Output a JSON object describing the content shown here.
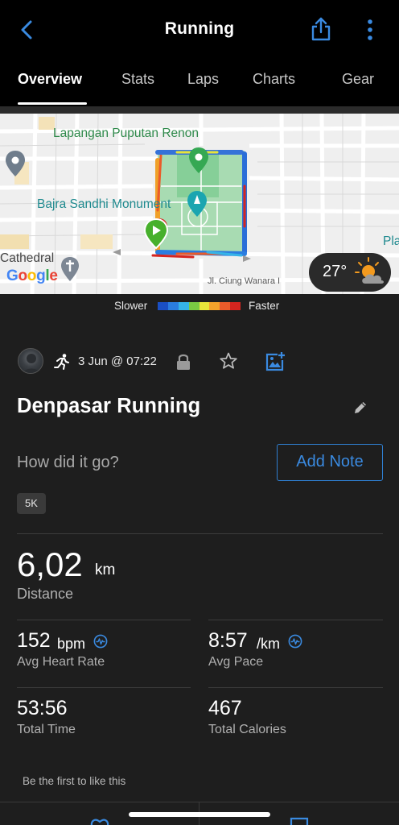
{
  "header": {
    "title": "Running",
    "tabs": [
      "Overview",
      "Stats",
      "Laps",
      "Charts",
      "Gear"
    ],
    "active_tab": "Overview"
  },
  "map": {
    "labels": {
      "park": "Lapangan Puputan Renon",
      "monument": "Bajra Sandhi Monument",
      "cathedral": "Cathedral",
      "street": "Jl. Ciung Wanara I",
      "edge_text": "Pla"
    },
    "attribution": "Google",
    "weather": {
      "temperature": "27°",
      "icon": "partly-cloudy-sun-icon"
    }
  },
  "legend": {
    "slower": "Slower",
    "faster": "Faster",
    "colors": [
      "#1a4fc4",
      "#2a7de0",
      "#35b4e8",
      "#7ac943",
      "#e7e53a",
      "#f4a32b",
      "#ea5b2a",
      "#d6251f"
    ]
  },
  "activity": {
    "activity_type_icon": "running-icon",
    "date": "3 Jun @ 07:22",
    "name": "Denpasar Running",
    "feedback_prompt": "How did it go?",
    "add_note_label": "Add Note",
    "tag": "5K"
  },
  "stats": {
    "distance": {
      "value": "6,02",
      "unit": "km",
      "label": "Distance"
    },
    "avg_heart_rate": {
      "value": "152",
      "unit": "bpm",
      "label": "Avg Heart Rate"
    },
    "avg_pace": {
      "value": "8:57",
      "unit": "/km",
      "label": "Avg Pace"
    },
    "total_time": {
      "value": "53:56",
      "label": "Total Time"
    },
    "total_calories": {
      "value": "467",
      "label": "Total Calories"
    }
  },
  "social": {
    "like_prompt": "Be the first to like this"
  },
  "colors": {
    "accent_blue": "#3a8ae0",
    "background": "#1e1e1e",
    "header": "#000000"
  }
}
